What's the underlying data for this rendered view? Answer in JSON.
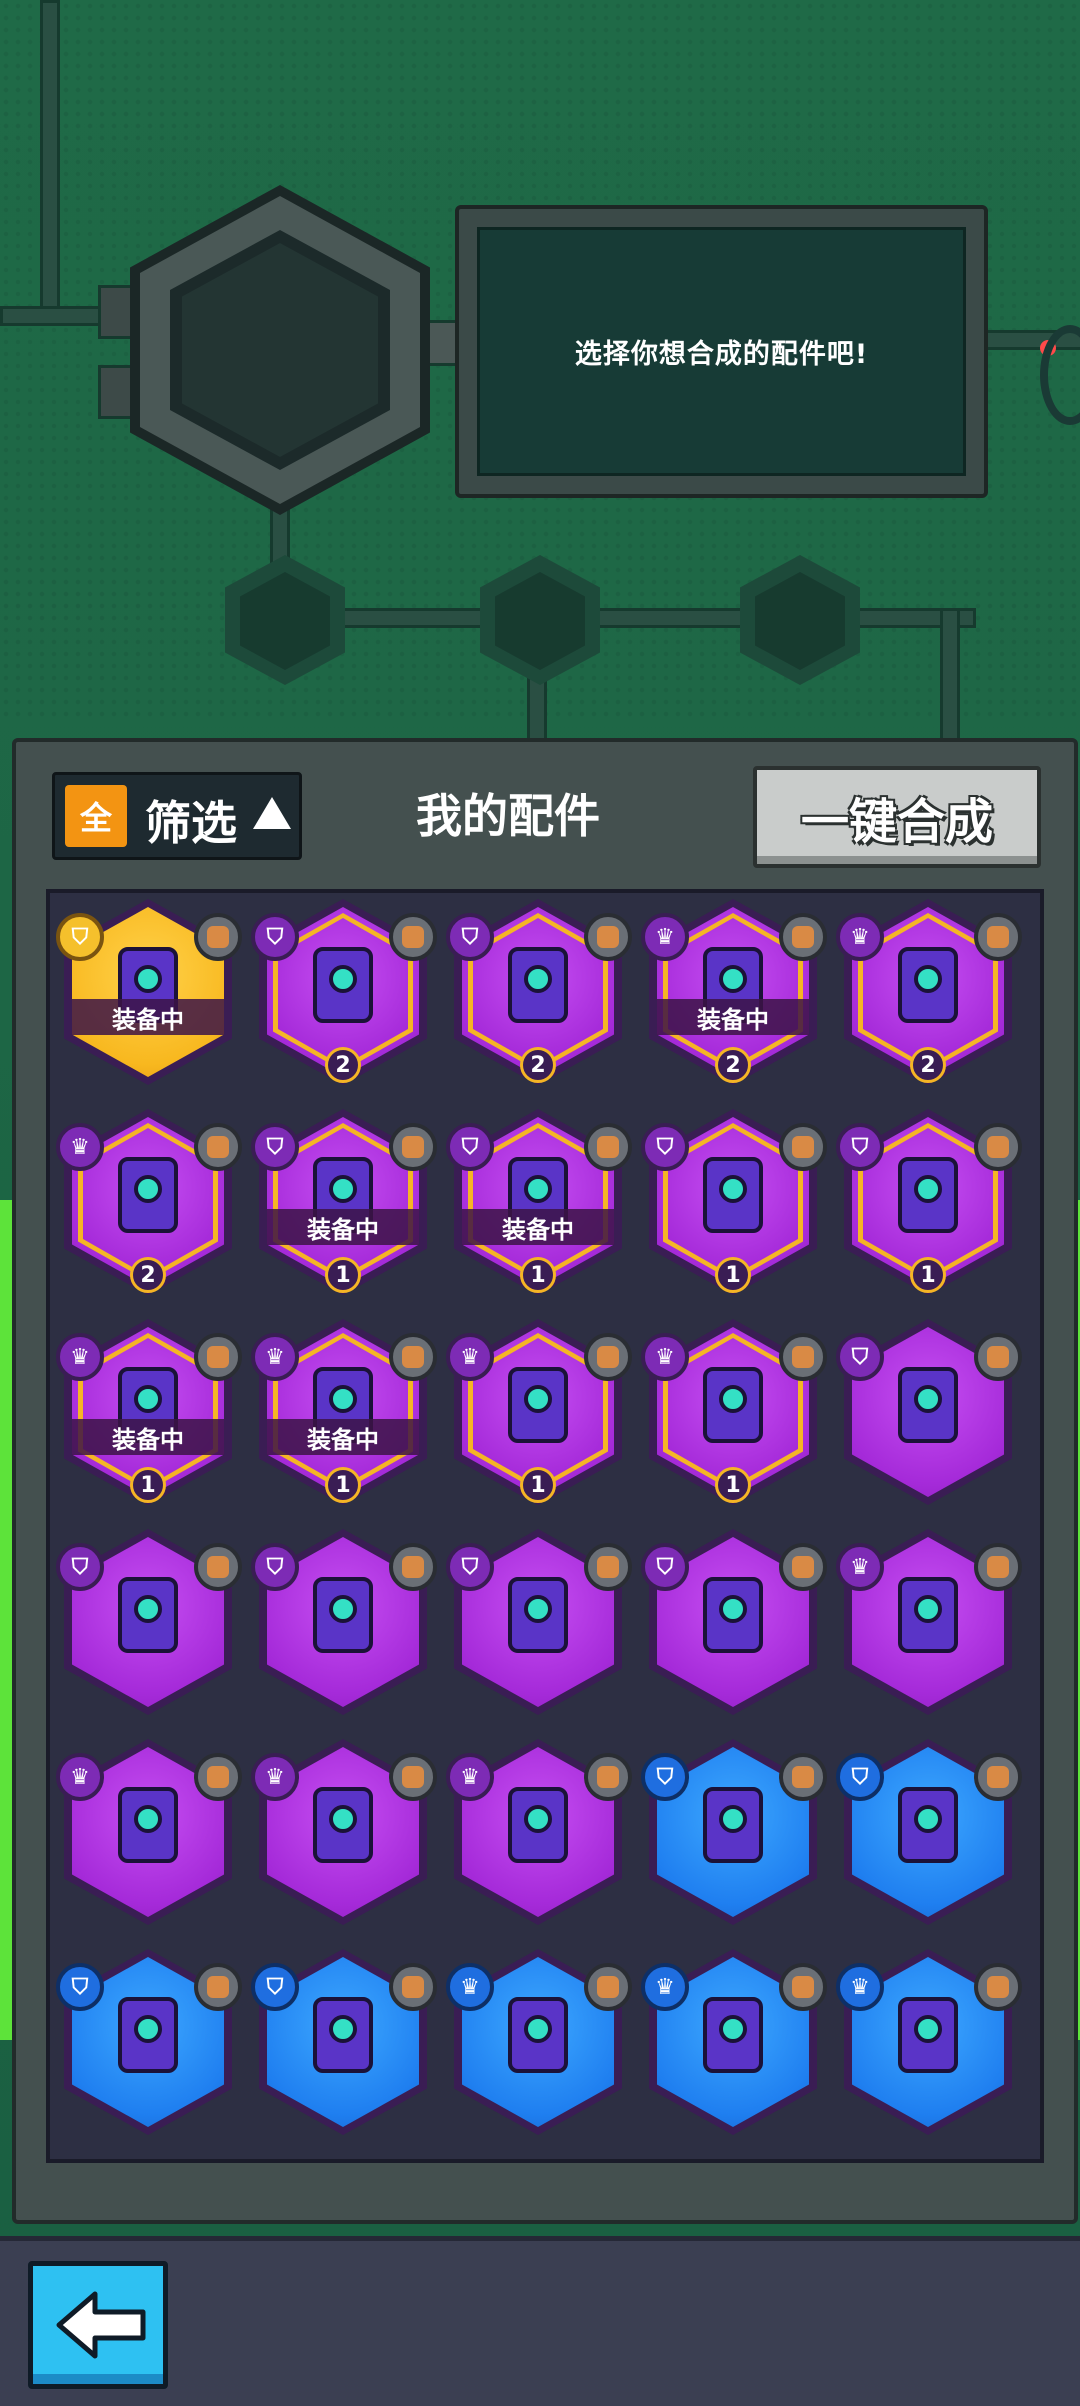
{
  "machine": {
    "prompt": "选择你想合成的配件吧!"
  },
  "panel": {
    "filter_all": "全",
    "filter_label": "筛选",
    "title": "我的配件",
    "merge_button": "一键合成"
  },
  "cards": [
    {
      "color": "gold",
      "tier": "shield",
      "equipped": "装备中",
      "count": "",
      "material": "brick-icon",
      "part": "backpack-part-icon"
    },
    {
      "color": "purple",
      "tier": "shield",
      "equipped": "",
      "count": "2",
      "material": "gift-icon",
      "part": "canister-part-icon"
    },
    {
      "color": "purple",
      "tier": "shield",
      "equipped": "",
      "count": "2",
      "material": "spike-ball-icon",
      "part": "orb-drone-part-icon"
    },
    {
      "color": "purple",
      "tier": "crown",
      "equipped": "装备中",
      "count": "2",
      "material": "cannon-icon",
      "part": "camera-part-icon"
    },
    {
      "color": "purple",
      "tier": "crown",
      "equipped": "",
      "count": "2",
      "material": "scroll-icon",
      "part": "arch-part-icon"
    },
    {
      "color": "purple",
      "tier": "crown",
      "equipped": "",
      "count": "2",
      "material": "bottle-icon",
      "part": "triangle-part-icon"
    },
    {
      "color": "purple",
      "tier": "shield",
      "equipped": "装备中",
      "count": "1",
      "material": "rocket-icon",
      "part": "wing-part-icon"
    },
    {
      "color": "purple",
      "tier": "shield",
      "equipped": "装备中",
      "count": "1",
      "material": "target-icon",
      "part": "boot-part-icon"
    },
    {
      "color": "purple",
      "tier": "shield",
      "equipped": "",
      "count": "1",
      "material": "brick-icon",
      "part": "screen-part-icon"
    },
    {
      "color": "purple",
      "tier": "shield",
      "equipped": "",
      "count": "1",
      "material": "boomerang-icon",
      "part": "speaker-part-icon"
    },
    {
      "color": "purple",
      "tier": "crown",
      "equipped": "装备中",
      "count": "1",
      "material": "horn-icon",
      "part": "lens-part-icon"
    },
    {
      "color": "purple",
      "tier": "crown",
      "equipped": "装备中",
      "count": "1",
      "material": "cone-icon",
      "part": "cabinet-part-icon"
    },
    {
      "color": "purple",
      "tier": "crown",
      "equipped": "",
      "count": "1",
      "material": "soccer-ball-icon",
      "part": "orb-drone-part-icon"
    },
    {
      "color": "purple",
      "tier": "crown",
      "equipped": "",
      "count": "1",
      "material": "cannon-icon",
      "part": "camera-part-icon"
    },
    {
      "color": "purple",
      "tier": "shield",
      "equipped": "",
      "count": "",
      "material": "rocket-icon",
      "part": "wing-part-icon"
    },
    {
      "color": "purple",
      "tier": "shield",
      "equipped": "",
      "count": "",
      "material": "gift-icon",
      "part": "canister-part-icon"
    },
    {
      "color": "purple",
      "tier": "shield",
      "equipped": "",
      "count": "",
      "material": "target-icon",
      "part": "boot-part-icon"
    },
    {
      "color": "purple",
      "tier": "shield",
      "equipped": "",
      "count": "",
      "material": "brick-icon",
      "part": "screen-part-icon"
    },
    {
      "color": "purple",
      "tier": "shield",
      "equipped": "",
      "count": "",
      "material": "boomerang-icon",
      "part": "speaker-part-icon"
    },
    {
      "color": "purple",
      "tier": "crown",
      "equipped": "",
      "count": "",
      "material": "horn-icon",
      "part": "lens-part-icon"
    },
    {
      "color": "purple",
      "tier": "crown",
      "equipped": "",
      "count": "",
      "material": "soccer-ball-icon",
      "part": "orb-drone-part-icon"
    },
    {
      "color": "purple",
      "tier": "crown",
      "equipped": "",
      "count": "",
      "material": "scroll-icon",
      "part": "arch-part-icon"
    },
    {
      "color": "purple",
      "tier": "crown",
      "equipped": "",
      "count": "",
      "material": "bottle-icon",
      "part": "triangle-part-icon"
    },
    {
      "color": "blue",
      "tier": "shield",
      "equipped": "",
      "count": "",
      "material": "gear-icon",
      "part": "canister-part-icon"
    },
    {
      "color": "blue",
      "tier": "shield",
      "equipped": "",
      "count": "",
      "material": "disc-icon",
      "part": "boot-part-icon"
    },
    {
      "color": "blue",
      "tier": "shield",
      "equipped": "",
      "count": "",
      "material": "spike-ball-icon",
      "part": "orb-drone-part-icon"
    },
    {
      "color": "blue",
      "tier": "shield",
      "equipped": "",
      "count": "",
      "material": "spike-ball-icon",
      "part": "orb-drone-part-icon"
    },
    {
      "color": "blue",
      "tier": "crown",
      "equipped": "",
      "count": "",
      "material": "drill-icon",
      "part": "lens-part-icon"
    },
    {
      "color": "blue",
      "tier": "crown",
      "equipped": "",
      "count": "",
      "material": "drill-icon",
      "part": "lens-part-icon"
    },
    {
      "color": "blue",
      "tier": "crown",
      "equipped": "",
      "count": "",
      "material": "cone-icon",
      "part": "cabinet-part-icon"
    }
  ],
  "colors": {
    "gold": "#f8b81f",
    "purple": "#a52ad9",
    "blue": "#1f7ff0",
    "accent_orange": "#f39412",
    "back_button": "#2ec1f2"
  },
  "bottom": {
    "back_icon": "back-arrow-icon"
  }
}
